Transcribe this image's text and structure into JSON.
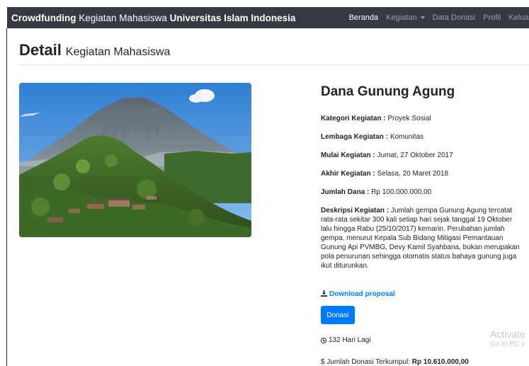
{
  "navbar": {
    "brand_bold1": "Crowdfunding",
    "brand_mid": "Kegiatan Mahasiswa",
    "brand_bold2": "Universitas Islam Indonesia",
    "items": [
      "Beranda",
      "Kegiatan",
      "Data Donasi",
      "Profil",
      "Keluar"
    ]
  },
  "page": {
    "title_bold": "Detail",
    "title_rest": "Kegiatan Mahasiswa"
  },
  "detail": {
    "name": "Dana Gunung Agung",
    "kategori_label": "Kategori Kegiatan :",
    "kategori_value": "Proyek Sosial",
    "lembaga_label": "Lembaga Kegiatan :",
    "lembaga_value": "Komunitas",
    "mulai_label": "Mulai Kegiatan :",
    "mulai_value": "Jumat, 27 Oktober 2017",
    "akhir_label": "Akhir Kegiatan :",
    "akhir_value": "Selasa, 20 Maret 2018",
    "dana_label": "Jumlah Dana :",
    "dana_value": "Rp 100.000.000,00",
    "deskripsi_label": "Deskripsi Kegiatan :",
    "deskripsi_value": "Jumlah gempa Gunung Agung tercatat rata-rata sekitar 300 kali setiap hari sejak tanggal 19 Oktober lalu hingga Rabu (25/10/2017) kemarin. Perubahan jumlah gempa, menurut Kepala Sub Bidang Mitigasi Pemantauan Gunung Api PVMBG, Devy Kamil Syahbana, bukan merupakan pola penurunan sehingga otomatis status bahaya gunung juga ikut diturunkan.",
    "download_label": "Download proposal",
    "donasi_button": "Donasi",
    "hari_lagi": "132 Hari Lagi",
    "terkumpul_label": "$ Jumlah Donasi Terkumpul:",
    "terkumpul_value": "Rp 10.610.000,00"
  },
  "watermark": {
    "line1": "Activate",
    "line2": "Go to PC s"
  },
  "colors": {
    "navbar": "#343a40",
    "primary": "#007bff"
  },
  "icons": [
    "download-icon",
    "clock-icon",
    "caret-down-icon"
  ]
}
